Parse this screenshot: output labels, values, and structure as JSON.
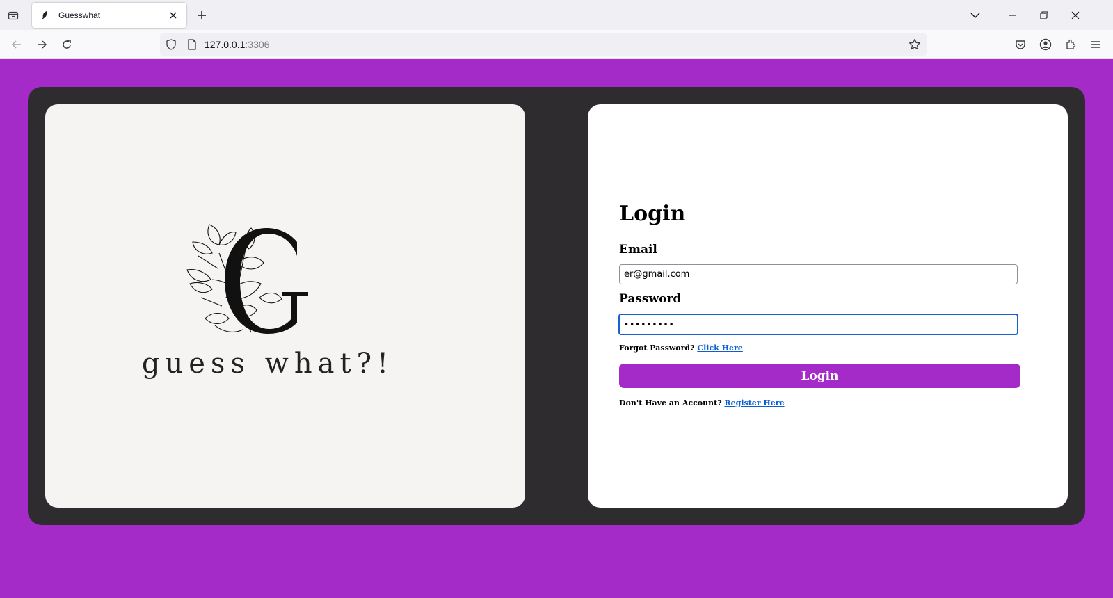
{
  "browser": {
    "tab": {
      "title": "Guesswhat"
    },
    "url": {
      "host": "127.0.0.1",
      "port": ":3306"
    }
  },
  "logo": {
    "text": "guess what?!"
  },
  "login": {
    "title": "Login",
    "email_label": "Email",
    "email_value": "er@gmail.com",
    "password_label": "Password",
    "password_value": "•••••••••",
    "forgot_text": "Forgot Password?",
    "forgot_link": "Click Here",
    "button_label": "Login",
    "register_text": "Don't Have an Account?",
    "register_link": "Register Here"
  },
  "colors": {
    "page_background": "#a52bc8",
    "container": "#2e2c2f",
    "button": "#a52bc8",
    "link": "#0b5fd3",
    "focus_ring": "#1a5fd6"
  }
}
